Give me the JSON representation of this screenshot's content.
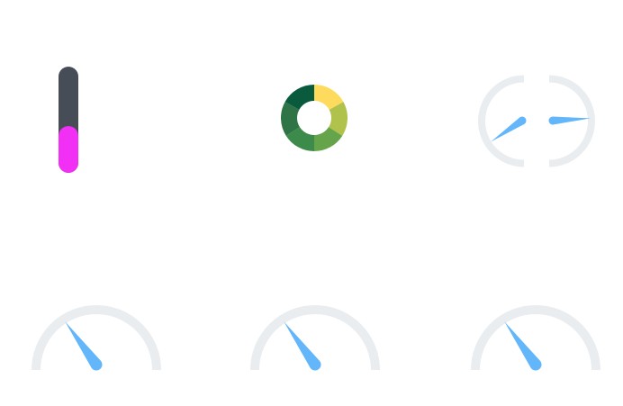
{
  "widgets": {
    "vertical_bar": {
      "value": 0.44,
      "track_color": "#474d57",
      "fill_color": "#f230f5"
    },
    "donut": {
      "segments": [
        {
          "value": 0.17,
          "color": "#fedb5c"
        },
        {
          "value": 0.17,
          "color": "#b0c24b"
        },
        {
          "value": 0.16,
          "color": "#66a44c"
        },
        {
          "value": 0.16,
          "color": "#3d8b4b"
        },
        {
          "value": 0.17,
          "color": "#2f7446"
        },
        {
          "value": 0.17,
          "color": "#0a5a3e"
        }
      ]
    },
    "split_gauge": {
      "track_color": "#e9edf0",
      "needle_color": "#64b6fb",
      "left_needle_value": 0.3,
      "right_needle_value": 0.52
    },
    "gauges": [
      {
        "value": 0.3,
        "track_color": "#e9edf0",
        "needle_color": "#64b6fb"
      },
      {
        "value": 0.3,
        "track_color": "#e9edf0",
        "needle_color": "#64b6fb"
      },
      {
        "value": 0.3,
        "track_color": "#e9edf0",
        "needle_color": "#64b6fb"
      }
    ]
  }
}
